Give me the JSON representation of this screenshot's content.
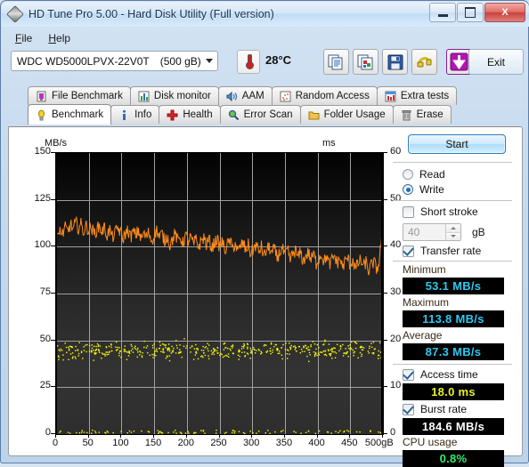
{
  "window": {
    "title": "HD Tune Pro 5.00 - Hard Disk Utility (Full version)",
    "app_icon": "diamond-disk-icon",
    "minimize_label": "Minimize",
    "maximize_label": "Maximize",
    "close_label": "X"
  },
  "menu": {
    "items": [
      {
        "label": "File",
        "mnemonic": "F"
      },
      {
        "label": "Help",
        "mnemonic": "H"
      }
    ]
  },
  "toolbar": {
    "drive": {
      "name": "WDC WD5000LPVX-22V0T",
      "capacity": "(500 gB)"
    },
    "temperature": "28°C",
    "buttons": [
      {
        "name": "copy-text-button",
        "icon": "copy-document-icon"
      },
      {
        "name": "copy-image-button",
        "icon": "copy-image-icon"
      },
      {
        "name": "save-button",
        "icon": "floppy-save-icon"
      },
      {
        "name": "settings-button",
        "icon": "cable-connector-icon"
      },
      {
        "name": "download-button",
        "icon": "purple-down-arrow-icon"
      }
    ],
    "exit_label": "Exit"
  },
  "tabs": {
    "row1": [
      {
        "label": "File Benchmark",
        "icon": "file-benchmark-icon",
        "active": false
      },
      {
        "label": "Disk monitor",
        "icon": "bar-chart-icon",
        "active": false
      },
      {
        "label": "AAM",
        "icon": "speaker-icon",
        "active": false
      },
      {
        "label": "Random Access",
        "icon": "scatter-icon",
        "active": false
      },
      {
        "label": "Extra tests",
        "icon": "extra-chart-icon",
        "active": false
      }
    ],
    "row2": [
      {
        "label": "Benchmark",
        "icon": "lightbulb-icon",
        "active": true
      },
      {
        "label": "Info",
        "icon": "info-icon",
        "active": false
      },
      {
        "label": "Health",
        "icon": "red-cross-icon",
        "active": false
      },
      {
        "label": "Error Scan",
        "icon": "magnifier-icon",
        "active": false
      },
      {
        "label": "Folder Usage",
        "icon": "folder-icon",
        "active": false
      },
      {
        "label": "Erase",
        "icon": "trash-icon",
        "active": false
      }
    ]
  },
  "controls": {
    "start_label": "Start",
    "mode": {
      "read_label": "Read",
      "write_label": "Write",
      "selected": "Write"
    },
    "short_stroke": {
      "label": "Short stroke",
      "checked": false,
      "value": "40",
      "unit": "gB"
    },
    "transfer_rate": {
      "label": "Transfer rate",
      "checked": true
    },
    "access_time": {
      "label": "Access time",
      "checked": true
    },
    "burst_rate": {
      "label": "Burst rate",
      "checked": true
    }
  },
  "results": {
    "minimum": {
      "label": "Minimum",
      "value": "53.1 MB/s",
      "color": "#2ec8f0"
    },
    "maximum": {
      "label": "Maximum",
      "value": "113.8 MB/s",
      "color": "#2ec8f0"
    },
    "average": {
      "label": "Average",
      "value": "87.3 MB/s",
      "color": "#2ec8f0"
    },
    "access_time": {
      "label": "Access time",
      "value": "18.0 ms",
      "color": "#e8f020"
    },
    "burst_rate": {
      "label": "Burst rate",
      "value": "184.6 MB/s",
      "color": "#ffffff"
    },
    "cpu_usage": {
      "label": "CPU usage",
      "value": "0.8%",
      "color": "#2ef06a"
    }
  },
  "chart_data": {
    "type": "line",
    "title": "",
    "xlabel": "",
    "ylabel": "MB/s",
    "ylabel_right": "ms",
    "xlim": [
      0,
      500
    ],
    "ylim": [
      0,
      150
    ],
    "ylim_right": [
      0,
      60
    ],
    "xticks": [
      0,
      50,
      100,
      150,
      200,
      250,
      300,
      350,
      400,
      450,
      500
    ],
    "xtick_labels": [
      "0",
      "50",
      "100",
      "150",
      "200",
      "250",
      "300",
      "350",
      "400",
      "450",
      "500gB"
    ],
    "yticks_left": [
      0,
      25,
      50,
      75,
      100,
      125,
      150
    ],
    "ytick_labels_left": [
      "0",
      "25",
      "50",
      "75",
      "100",
      "125",
      "150"
    ],
    "yticks_right": [
      0,
      10,
      20,
      30,
      40,
      50,
      60
    ],
    "ytick_labels_right": [
      "0",
      "10",
      "20",
      "30",
      "40",
      "50",
      "60"
    ],
    "grid": true,
    "legend": "none",
    "background": "#1a1a1a",
    "series": [
      {
        "name": "Transfer rate",
        "type": "line",
        "color": "#ff8c1a",
        "axis": "left",
        "unit": "MB/s",
        "x": [
          2,
          6,
          10,
          14,
          18,
          22,
          26,
          30,
          34,
          38,
          42,
          46,
          50,
          54,
          58,
          62,
          66,
          70,
          74,
          78,
          82,
          86,
          90,
          94,
          98,
          102,
          106,
          110,
          114,
          118,
          122,
          126,
          130,
          134,
          138,
          142,
          146,
          150,
          154,
          158,
          162,
          166,
          170,
          174,
          178,
          182,
          186,
          190,
          194,
          198,
          202,
          206,
          210,
          214,
          218,
          222,
          226,
          230,
          234,
          238,
          242,
          246,
          250,
          254,
          258,
          262,
          266,
          270,
          274,
          278,
          282,
          286,
          290,
          294,
          298,
          302,
          306,
          310,
          314,
          318,
          322,
          326,
          330,
          334,
          338,
          342,
          346,
          350,
          354,
          358,
          362,
          366,
          370,
          374,
          378,
          382,
          386,
          390,
          394,
          398,
          402,
          406,
          410,
          414,
          418,
          422,
          426,
          430,
          434,
          438,
          442,
          446,
          450,
          454,
          458,
          462,
          466,
          470,
          474,
          478,
          482,
          486,
          490,
          494,
          498
        ],
        "y": [
          106,
          109,
          107,
          110,
          108,
          112,
          109,
          113,
          110,
          112,
          108,
          111,
          109,
          110,
          107,
          109,
          111,
          108,
          110,
          106,
          109,
          105,
          107,
          110,
          108,
          104,
          107,
          109,
          105,
          108,
          106,
          109,
          104,
          107,
          105,
          108,
          103,
          106,
          109,
          105,
          107,
          103,
          106,
          101,
          104,
          107,
          103,
          105,
          102,
          106,
          103,
          105,
          101,
          104,
          100,
          103,
          105,
          101,
          104,
          99,
          102,
          104,
          100,
          103,
          98,
          101,
          103,
          99,
          102,
          97,
          100,
          102,
          98,
          101,
          96,
          99,
          101,
          97,
          100,
          95,
          98,
          100,
          96,
          99,
          94,
          97,
          99,
          95,
          98,
          93,
          96,
          98,
          94,
          97,
          92,
          95,
          97,
          93,
          96,
          91,
          94,
          96,
          92,
          95,
          90,
          93,
          95,
          91,
          94,
          89,
          92,
          94,
          90,
          93,
          88,
          91,
          93,
          89,
          92,
          87,
          90,
          92,
          88,
          91,
          105
        ]
      },
      {
        "name": "Access time",
        "type": "scatter",
        "color": "#ffff00",
        "axis": "right",
        "unit": "ms",
        "mean": 18.0,
        "spread": [
          12,
          24
        ],
        "point_count": 600,
        "note": "Random-access latency samples scattered around 18 ms, plus a dense baseline row of near-0 ms samples along the bottom axis."
      }
    ]
  }
}
